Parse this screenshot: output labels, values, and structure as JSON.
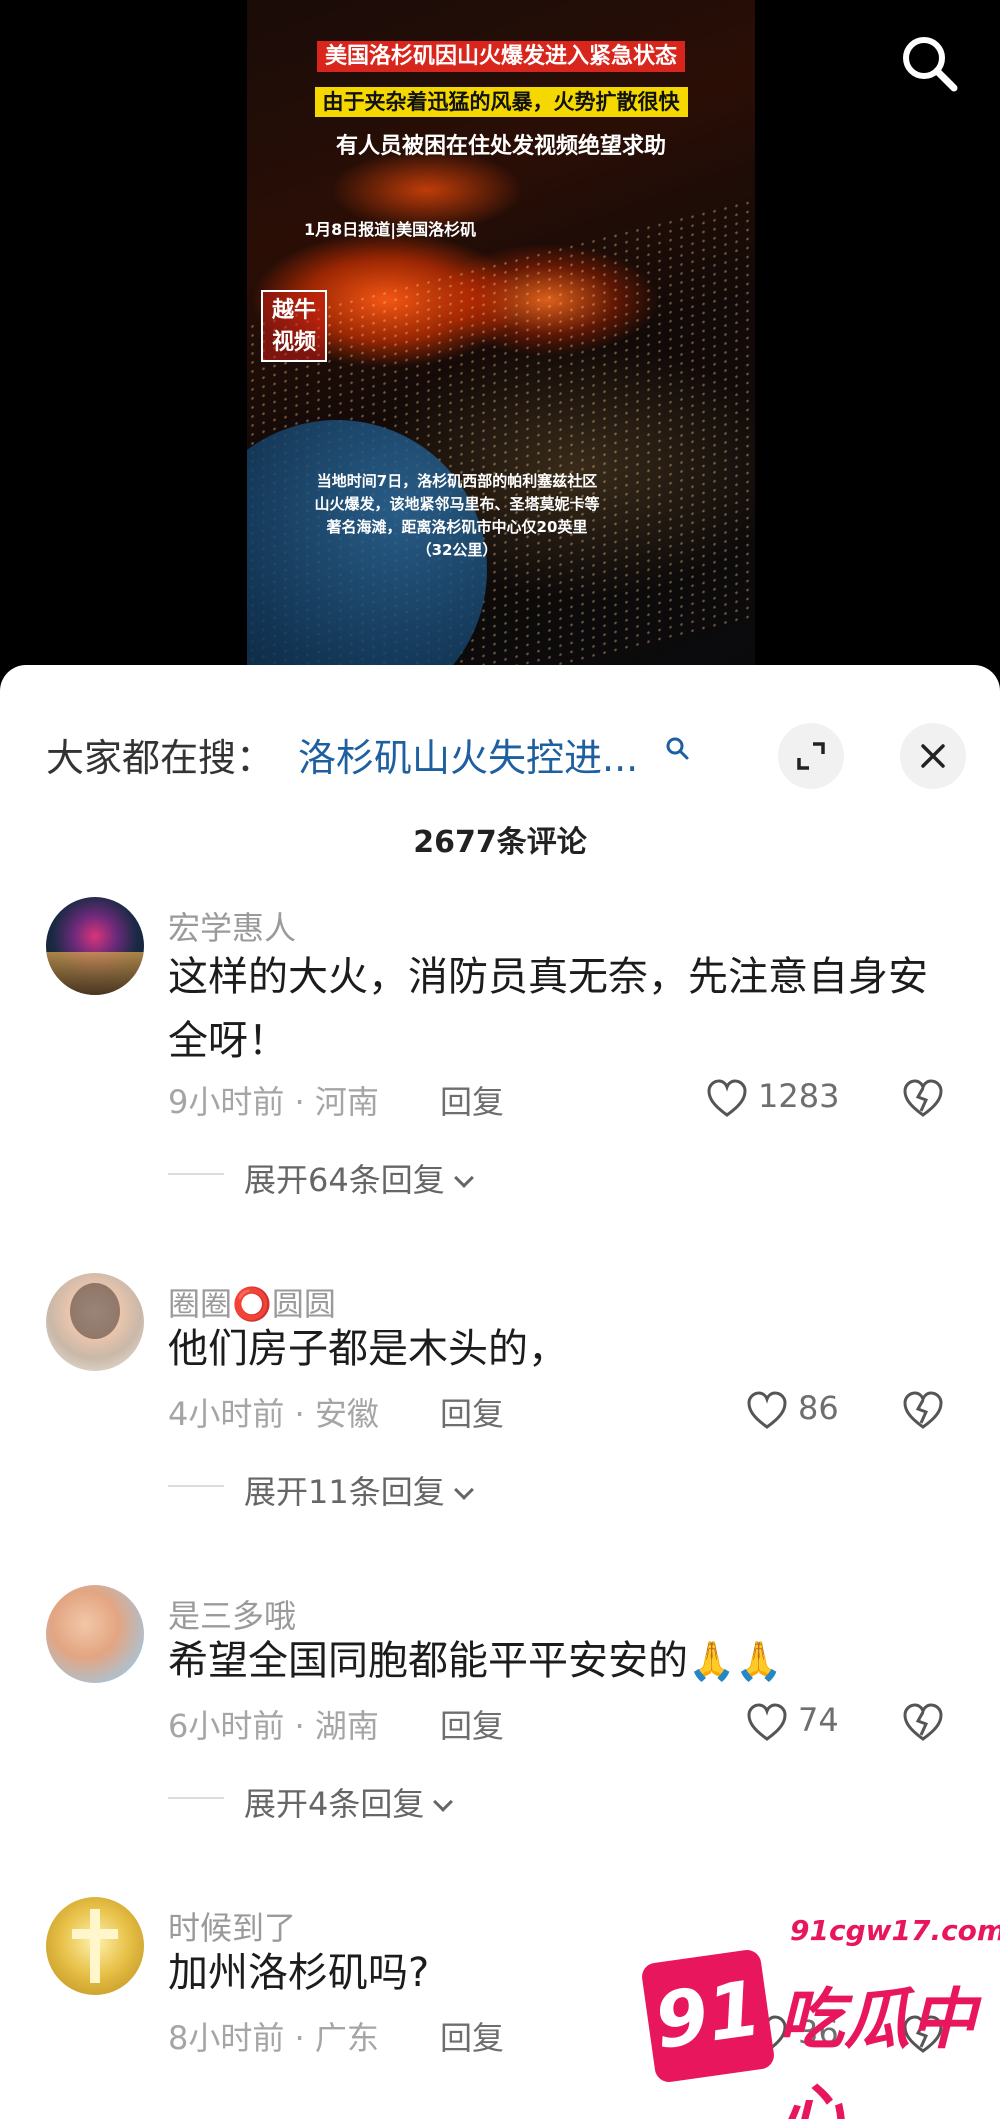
{
  "video": {
    "title_line1": "美国洛杉矶因山火爆发进入紧急状态",
    "title_line2": "由于夹杂着迅猛的风暴，火势扩散很快",
    "title_line3": "有人员被困在住处发视频绝望求助",
    "date_source": "1月8日报道|美国洛杉矶",
    "logo_line1": "越牛",
    "logo_line2": "视频",
    "caption_line1": "当地时间7日，洛杉矶西部的帕利塞兹社区",
    "caption_line2": "山火爆发，该地紧邻马里布、圣塔莫妮卡等",
    "caption_line3": "著名海滩，距离洛杉矶市中心仅20英里",
    "caption_line4": "（32公里）"
  },
  "search_bar": {
    "label": "大家都在搜：",
    "link_text": "洛杉矶山火失控进...",
    "link_color": "#1e5fa0"
  },
  "comments_count": "2677条评论",
  "comments": [
    {
      "username": "宏学惠人",
      "text": "这样的大火，消防员真无奈，先注意自身安全呀！",
      "meta": "9小时前 · 河南",
      "reply_label": "回复",
      "likes": "1283",
      "expand": "展开64条回复"
    },
    {
      "username": "圈圈⭕圆圆",
      "text": "他们房子都是木头的，",
      "meta": "4小时前 · 安徽",
      "reply_label": "回复",
      "likes": "86",
      "expand": "展开11条回复"
    },
    {
      "username": "是三多哦",
      "text": "希望全国同胞都能平平安安的",
      "text_emoji": "🙏🙏",
      "meta": "6小时前 · 湖南",
      "reply_label": "回复",
      "likes": "74",
      "expand": "展开4条回复"
    },
    {
      "username": "时候到了",
      "text": "加州洛杉矶吗?",
      "meta": "8小时前 · 广东",
      "reply_label": "回复",
      "likes": "36"
    }
  ],
  "watermark": {
    "url": "91cgw17.com",
    "badge": "91",
    "text": "吃瓜中心",
    "color": "#e8175d"
  },
  "icons": [
    "search-icon",
    "expand-icon",
    "close-icon",
    "heart-icon",
    "dislike-icon",
    "chevron-down-icon"
  ]
}
